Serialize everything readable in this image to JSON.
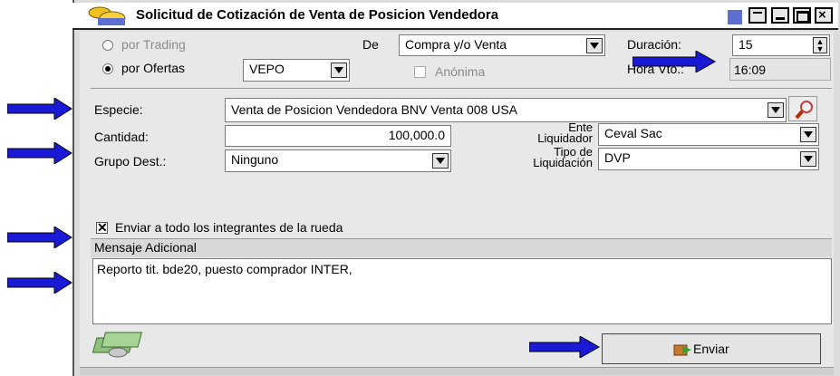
{
  "window": {
    "title": "Solicitud de Cotización de Venta de Posicion Vendedora"
  },
  "options": {
    "por_trading": "por Trading",
    "por_ofertas": "por Ofertas",
    "tipo_oferta": "VEPO",
    "de_label": "De",
    "de_value": "Compra y/o Venta",
    "anonima": "Anónima",
    "duracion_label": "Duración:",
    "duracion_value": "15",
    "hora_vto_label": "Hora Vto.:",
    "hora_vto_value": "16:09"
  },
  "form": {
    "especie_label": "Especie:",
    "especie_value": "Venta de Posicion Vendedora BNV Venta 008 USA",
    "cantidad_label": "Cantidad:",
    "cantidad_value": "100,000.0",
    "ente_label_1": "Ente",
    "ente_label_2": "Liquidador",
    "ente_value": "Ceval Sac",
    "grupo_label": "Grupo Dest.:",
    "grupo_value": "Ninguno",
    "tipo_liq_label_1": "Tipo de",
    "tipo_liq_label_2": "Liquidación",
    "tipo_liq_value": "DVP"
  },
  "enviar_todos": {
    "label": "Enviar a todo los integrantes de la rueda",
    "checked": true
  },
  "mensaje": {
    "label": "Mensaje Adicional",
    "text": "Reporto tit. bde20, puesto comprador INTER,"
  },
  "footer": {
    "enviar_label": "Enviar"
  },
  "colors": {
    "arrow": "#1a1ad6",
    "title_accent": "#5d6fd0"
  }
}
